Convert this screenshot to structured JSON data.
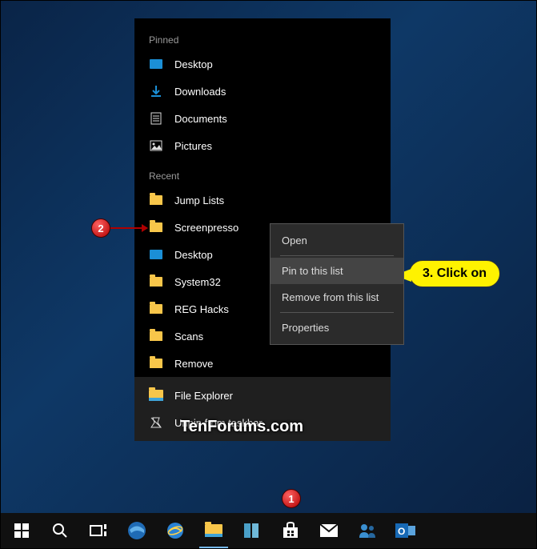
{
  "pinned_header": "Pinned",
  "recent_header": "Recent",
  "pinned": [
    {
      "label": "Desktop",
      "icon": "desktop"
    },
    {
      "label": "Downloads",
      "icon": "download"
    },
    {
      "label": "Documents",
      "icon": "document"
    },
    {
      "label": "Pictures",
      "icon": "picture"
    }
  ],
  "recent": [
    {
      "label": "Jump Lists",
      "icon": "folder"
    },
    {
      "label": "Screenpresso",
      "icon": "folder"
    },
    {
      "label": "Desktop",
      "icon": "desktop"
    },
    {
      "label": "System32",
      "icon": "folder"
    },
    {
      "label": "REG Hacks",
      "icon": "folder"
    },
    {
      "label": "Scans",
      "icon": "folder"
    },
    {
      "label": "Remove",
      "icon": "folder"
    }
  ],
  "app_row": {
    "label": "File Explorer"
  },
  "unpin_row": {
    "label": "Unpin from taskbar"
  },
  "context": {
    "open": "Open",
    "pin": "Pin to this list",
    "remove": "Remove from this list",
    "properties": "Properties"
  },
  "callout_text": "3. Click on",
  "step1": "1",
  "step2": "2",
  "watermark": "TenForums.com"
}
